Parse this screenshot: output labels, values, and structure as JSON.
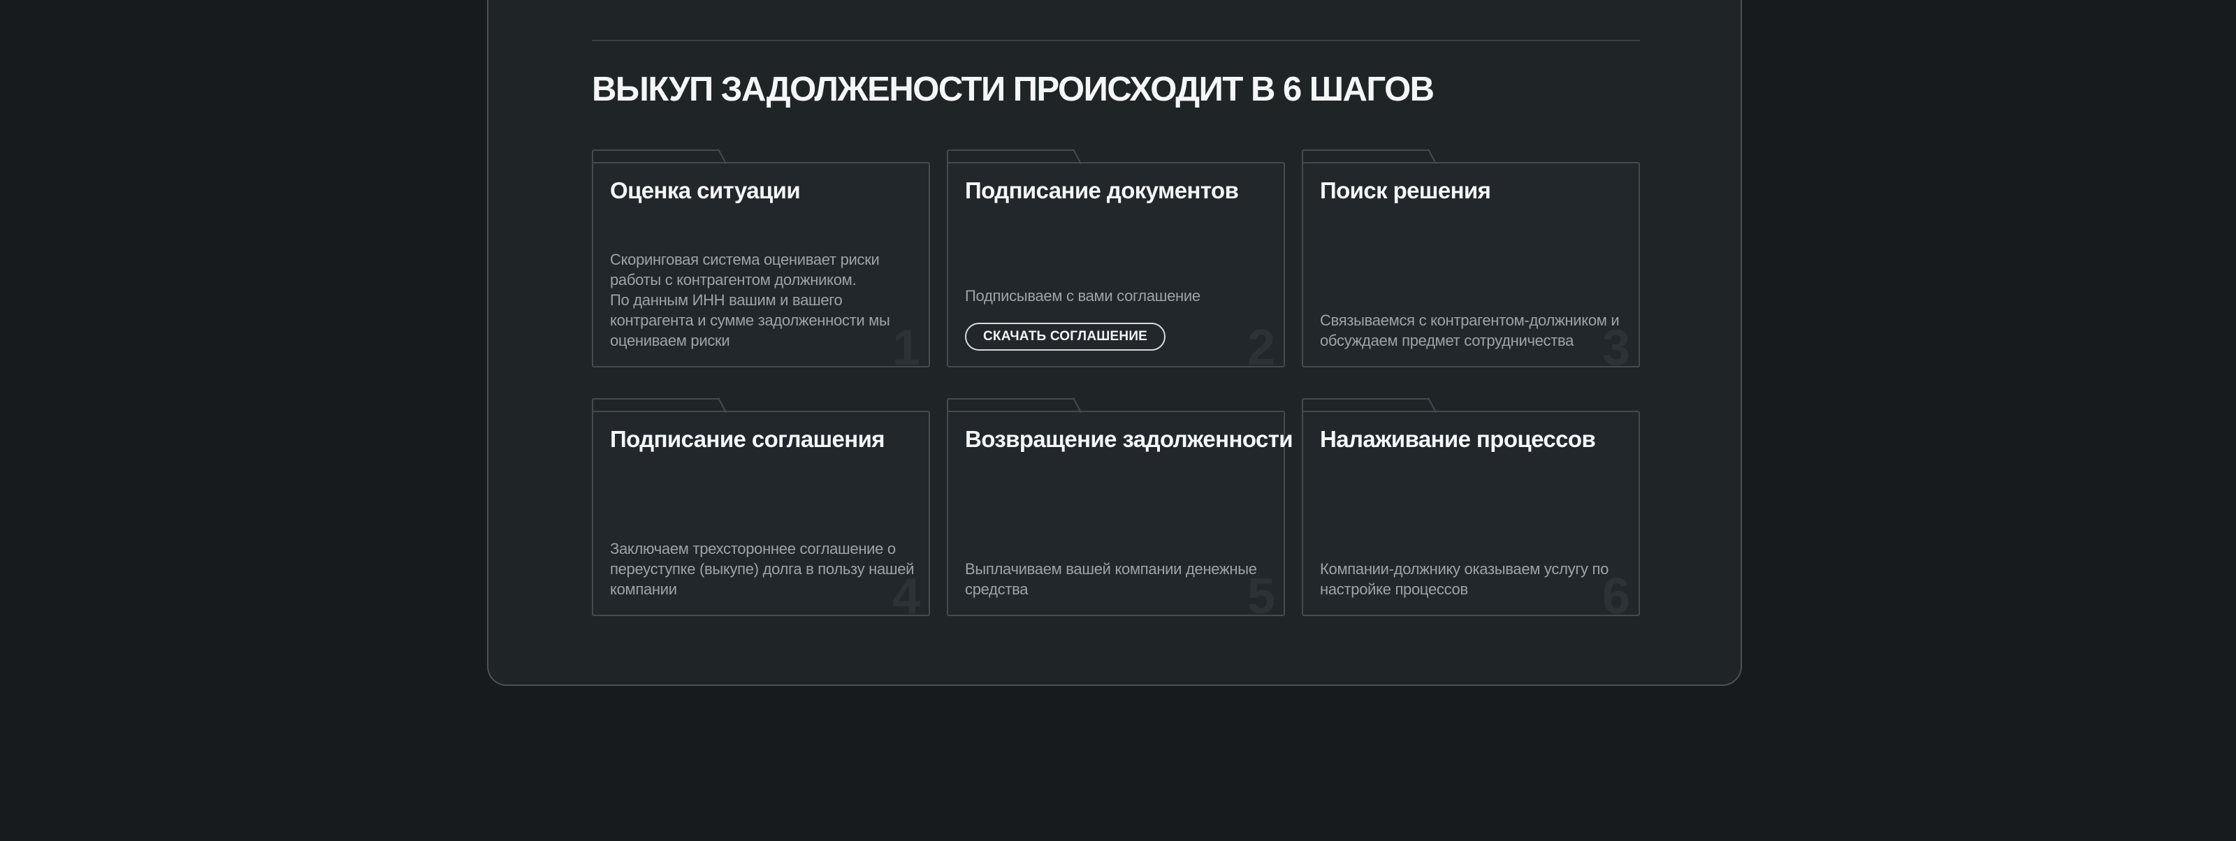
{
  "section": {
    "title": "ВЫКУП ЗАДОЛЖЕНОСТИ ПРОИСХОДИТ В 6 ШАГОВ"
  },
  "steps": [
    {
      "number": "1",
      "title": "Оценка ситуации",
      "description": "Скоринговая система оценивает риски работы с контрагентом должником.\nПо данным ИНН вашим и вашего контрагента и сумме задолженности мы оцениваем риски"
    },
    {
      "number": "2",
      "title": "Подписание документов",
      "description": "Подписываем с вами соглашение",
      "button_label": "СКАЧАТЬ СОГЛАШЕНИЕ"
    },
    {
      "number": "3",
      "title": "Поиск решения",
      "description": "Связываемся с контрагентом-должником и обсуждаем предмет сотрудничества"
    },
    {
      "number": "4",
      "title": "Подписание соглашения",
      "description": "Заключаем трехстороннее соглашение о переуступке (выкупе) долга в пользу нашей компании"
    },
    {
      "number": "5",
      "title": "Возвращение задолженности",
      "description": "Выплачиваем вашей компании денежные средства"
    },
    {
      "number": "6",
      "title": "Налаживание процессов",
      "description": "Компании-должнику оказываем услугу по настройке процессов"
    }
  ]
}
